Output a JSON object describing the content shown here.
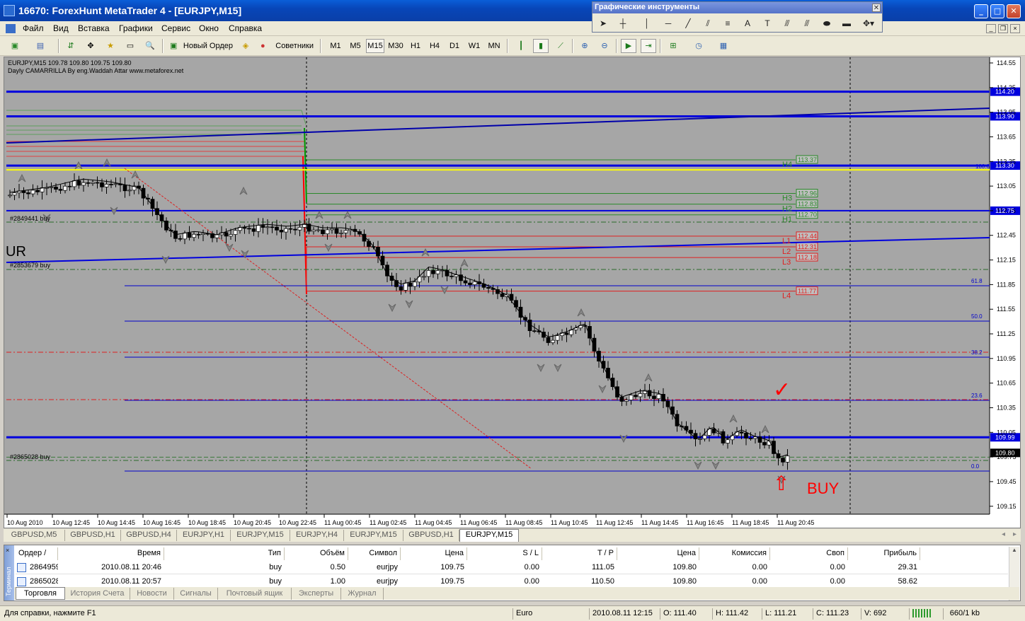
{
  "window": {
    "title": "16670: ForexHunt MetaTrader 4 - [EURJPY,M15]"
  },
  "menu": [
    "Файл",
    "Вид",
    "Вставка",
    "Графики",
    "Сервис",
    "Окно",
    "Справка"
  ],
  "toolbar": {
    "new_order": "Новый Ордер",
    "experts": "Советники",
    "timeframes": [
      "M1",
      "M5",
      "M15",
      "M30",
      "H1",
      "H4",
      "D1",
      "W1",
      "MN"
    ],
    "active_timeframe": "M15"
  },
  "graphic_tools": {
    "title": "Графические инструменты"
  },
  "chart": {
    "header_line1": "EURJPY,M15  109.78 109.80 109.75 109.80",
    "header_line2": "Dayly CAMARRILLA By eng.Waddah Attar www.metaforex.net",
    "ur_label": "UR",
    "buy_label": "BUY",
    "check_mark": "✓",
    "arrow_up": "⇧",
    "trade_labels": [
      "#2849441 buy",
      "#2853679 buy",
      "#2865028 buy"
    ],
    "price_axis": [
      "114.55",
      "114.25",
      "113.95",
      "113.65",
      "113.35",
      "113.05",
      "112.75",
      "112.45",
      "112.15",
      "111.85",
      "111.55",
      "111.25",
      "110.95",
      "110.65",
      "110.35",
      "110.05",
      "109.75",
      "109.45",
      "109.15"
    ],
    "price_tags": {
      "blue1": "114.20",
      "blue2": "113.90",
      "yellow": "113.30",
      "blue3": "112.75",
      "black": "109.80",
      "blue4": "109.99"
    },
    "yellow_label": "100.0",
    "camarilla": [
      {
        "name": "H4",
        "value": "113.37"
      },
      {
        "name": "H3",
        "value": "112.96"
      },
      {
        "name": "H2",
        "value": "112.83"
      },
      {
        "name": "H1",
        "value": "112.70"
      },
      {
        "name": "L1",
        "value": "112.44"
      },
      {
        "name": "L2",
        "value": "112.31"
      },
      {
        "name": "L3",
        "value": "112.18"
      },
      {
        "name": "L4",
        "value": "111.77"
      }
    ],
    "fib_levels": [
      "61.8",
      "50.0",
      "38.2",
      "23.6",
      "0.0"
    ],
    "time_axis": [
      "10 Aug 2010",
      "10 Aug 12:45",
      "10 Aug 14:45",
      "10 Aug 16:45",
      "10 Aug 18:45",
      "10 Aug 20:45",
      "10 Aug 22:45",
      "11 Aug 00:45",
      "11 Aug 02:45",
      "11 Aug 04:45",
      "11 Aug 06:45",
      "11 Aug 08:45",
      "11 Aug 10:45",
      "11 Aug 12:45",
      "11 Aug 14:45",
      "11 Aug 16:45",
      "11 Aug 18:45",
      "11 Aug 20:45"
    ]
  },
  "chart_tabs": [
    "GBPUSD,M5",
    "GBPUSD,H1",
    "GBPUSD,H4",
    "EURJPY,H1",
    "EURJPY,M15",
    "EURJPY,H4",
    "EURJPY,M15",
    "GBPUSD,H1",
    "EURJPY,M15"
  ],
  "terminal": {
    "side_label": "Терминал",
    "columns": [
      "Ордер",
      "/",
      "Время",
      "Тип",
      "Объём",
      "Символ",
      "Цена",
      "S / L",
      "T / P",
      "Цена",
      "Комиссия",
      "Своп",
      "Прибыль"
    ],
    "rows": [
      [
        "2864959",
        "2010.08.11 20:46",
        "buy",
        "0.50",
        "eurjpy",
        "109.75",
        "0.00",
        "111.05",
        "109.80",
        "0.00",
        "0.00",
        "29.31"
      ],
      [
        "2865028",
        "2010.08.11 20:57",
        "buy",
        "1.00",
        "eurjpy",
        "109.75",
        "0.00",
        "110.50",
        "109.80",
        "0.00",
        "0.00",
        "58.62"
      ]
    ],
    "tabs": [
      "Торговля",
      "История Счета",
      "Новости",
      "Сигналы",
      "Почтовый ящик",
      "Эксперты",
      "Журнал"
    ]
  },
  "status": {
    "help": "Для справки, нажмите F1",
    "profile": "Euro",
    "datetime": "2010.08.11 12:15",
    "open": "O: 111.40",
    "high": "H: 111.42",
    "low": "L: 111.21",
    "close": "C: 111.23",
    "volume": "V: 692",
    "traffic": "660/1 kb"
  }
}
